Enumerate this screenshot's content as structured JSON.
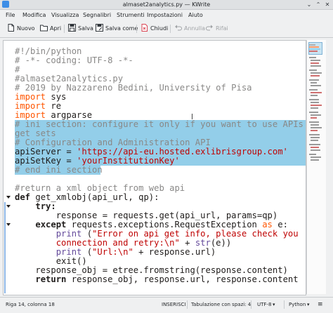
{
  "window": {
    "title": "almaset2analytics.py — KWrite",
    "minimize_glyph": "⌄",
    "maximize_glyph": "⌃",
    "close_glyph": "✕"
  },
  "menu": [
    "File",
    "Modifica",
    "Visualizza",
    "Segnalibri",
    "Strumenti",
    "Impostazioni",
    "Aiuto"
  ],
  "toolbar": {
    "new_label": "Nuovo",
    "open_label": "Apri",
    "save_label": "Salva",
    "save_as_label": "Salva come",
    "close_label": "Chiudi",
    "undo_label": "Annulla",
    "redo_label": "Rifai"
  },
  "editor": {
    "lines": [
      "#!/bin/python",
      "# -*- coding: UTF-8 -*-",
      "#",
      "#almaset2analytics.py",
      "# 2019 by Nazzareno Bedini, University of Pisa",
      "import sys",
      "import re",
      "import argparse",
      "",
      "# ini section: configure it only if you want to use APIs to",
      "get sets",
      "# Configuration and Administration API",
      "apiServer = 'https://api-eu.hosted.exlibrisgroup.com'",
      "apiSetKey = 'yourInstitutionKey'",
      "# end ini section",
      "",
      "#return a xml object from web api",
      "def get_xmlobj(api_url, qp):",
      "    try:",
      "        response = requests.get(api_url, params=qp)",
      "    except requests.exceptions.RequestException as e:",
      "        print (\"Error on api get info, please check you",
      "        connection and retry:\\n\" + str(e))",
      "        print (\"Url:\\n\" + response.url)",
      "        exit()",
      "    response_obj = etree.fromstring(response.content)",
      "    return response_obj, response.url, response.content"
    ],
    "keywords": {
      "import": "import",
      "def": "def",
      "try": "try:",
      "except": "except",
      "as": "as",
      "print": "print",
      "return": "return"
    },
    "tokens": {
      "sys": " sys",
      "re": " re",
      "argparse": " argparse",
      "api_server_name": "apiServer = ",
      "api_server_value": "'https://api-eu.hosted.exlibrisgroup.com'",
      "api_setkey_name": "apiSetKey = ",
      "api_setkey_value": "'yourInstitutionKey'",
      "def_rest": " get_xmlobj(api_url, qp):",
      "indent4": "    ",
      "indent8": "        ",
      "except_mid": " requests.exceptions.RequestException ",
      "except_end": " e:",
      "print1_open": " (",
      "print1_str": "\"Error on api get info, please check you",
      "print2_str": "connection and retry:\\n\"",
      "print2_rest": " + ",
      "str_fn": "str",
      "print2_end": "(e))",
      "print3_str": "\"Url:\\n\"",
      "print3_rest": " + response.url)",
      "return_rest": " response_obj, response.url, response.content"
    },
    "colors": {
      "selection": "#93cee9",
      "comment": "#898887",
      "string": "#bf0303",
      "import": "#ff5500",
      "builtin": "#644a9b"
    }
  },
  "statusbar": {
    "position": "Riga 14, colonna 18",
    "mode": "INSERISCI",
    "indent": "Tabulazione con spazi: 4",
    "encoding": "UTF-8",
    "language": "Python"
  }
}
